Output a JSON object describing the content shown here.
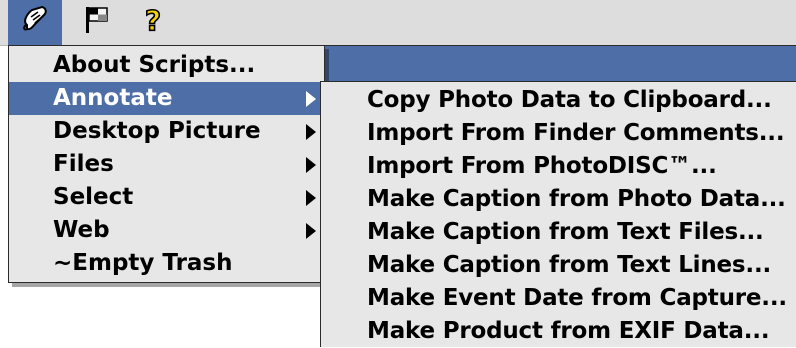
{
  "menubar": {
    "scripts_icon": "script-scroll-icon",
    "finder_icon": "finder-flag-icon",
    "help_icon": "help-question-icon",
    "help_glyph": "?"
  },
  "scripts_menu": {
    "items": [
      {
        "label": "About Scripts...",
        "submenu": false
      },
      {
        "label": "Annotate",
        "submenu": true,
        "selected": true
      },
      {
        "label": "Desktop Picture",
        "submenu": true
      },
      {
        "label": "Files",
        "submenu": true
      },
      {
        "label": "Select",
        "submenu": true
      },
      {
        "label": "Web",
        "submenu": true
      },
      {
        "label": "~Empty Trash",
        "submenu": false
      }
    ]
  },
  "annotate_submenu": {
    "items": [
      {
        "label": "Copy Photo Data to Clipboard..."
      },
      {
        "label": "Import From Finder Comments..."
      },
      {
        "label": "Import From PhotoDISC™..."
      },
      {
        "label": "Make Caption from Photo Data..."
      },
      {
        "label": "Make Caption from Text Files..."
      },
      {
        "label": "Make Caption from Text Lines..."
      },
      {
        "label": "Make Event Date from Capture..."
      },
      {
        "label": "Make Product from EXIF Data..."
      }
    ]
  },
  "colors": {
    "highlight": "#4d6ea7",
    "menu_bg": "#e7e7e7",
    "menubar_bg": "#dddddd",
    "help_yellow": "#f3d400"
  }
}
